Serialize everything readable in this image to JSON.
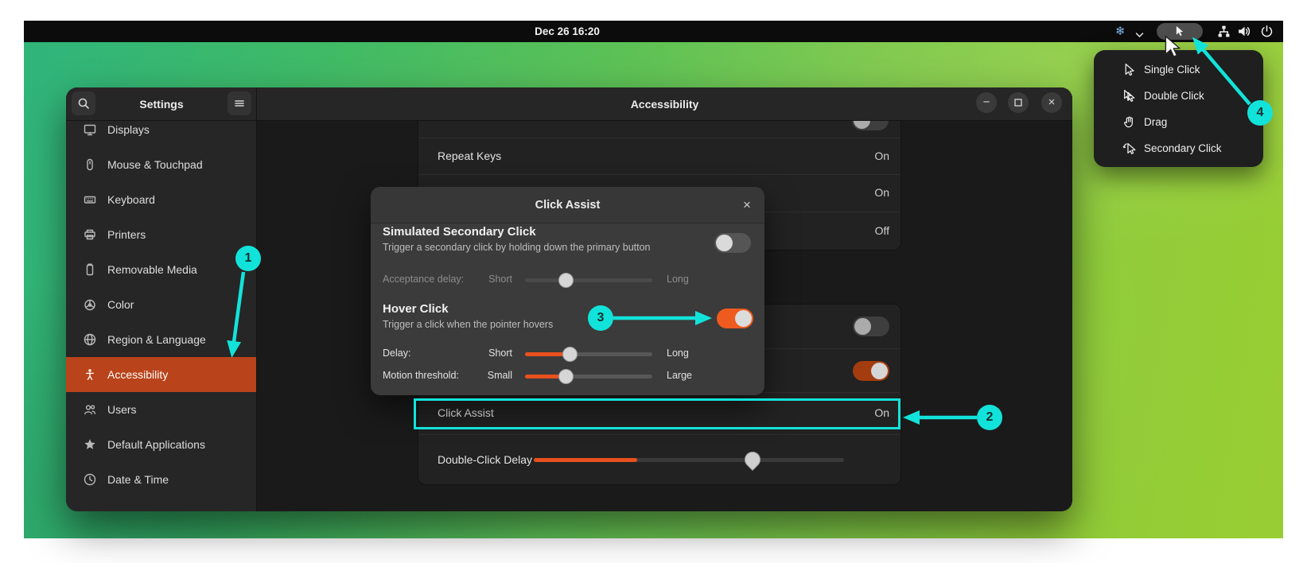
{
  "topbar": {
    "clock": "Dec 26 16:20",
    "snowflake_icon": "❄"
  },
  "tray_menu": {
    "items": [
      {
        "icon": "single-click-cursor-icon",
        "label": "Single Click"
      },
      {
        "icon": "double-click-cursor-icon",
        "label": "Double Click"
      },
      {
        "icon": "drag-hand-icon",
        "label": "Drag"
      },
      {
        "icon": "secondary-click-cursor-icon",
        "label": "Secondary Click"
      }
    ]
  },
  "window": {
    "sidebar_title": "Settings",
    "sidebar_items": [
      {
        "icon": "display-icon",
        "label": "Displays"
      },
      {
        "icon": "mouse-icon",
        "label": "Mouse & Touchpad"
      },
      {
        "icon": "keyboard-icon",
        "label": "Keyboard"
      },
      {
        "icon": "printer-icon",
        "label": "Printers"
      },
      {
        "icon": "removable-media-icon",
        "label": "Removable Media"
      },
      {
        "icon": "color-icon",
        "label": "Color"
      },
      {
        "icon": "globe-icon",
        "label": "Region & Language"
      },
      {
        "icon": "accessibility-icon",
        "label": "Accessibility",
        "selected": true
      },
      {
        "icon": "users-icon",
        "label": "Users"
      },
      {
        "icon": "star-icon",
        "label": "Default Applications"
      },
      {
        "icon": "clock-icon",
        "label": "Date & Time"
      }
    ],
    "title": "Accessibility",
    "controls": {
      "minimize": "−",
      "close": "×"
    },
    "typing_card": {
      "rows": [
        {
          "label": "Repeat Keys",
          "value": "On"
        },
        {
          "value": "On"
        },
        {
          "value": "Off"
        }
      ]
    },
    "pointing_card": {
      "click_assist": {
        "label": "Click Assist",
        "value": "On"
      },
      "double_click_delay": {
        "label": "Double-Click Delay"
      }
    }
  },
  "dialog": {
    "title": "Click Assist",
    "close": "×",
    "simulated_secondary_click": {
      "title": "Simulated Secondary Click",
      "subtitle": "Trigger a secondary click by holding down the primary button",
      "toggle": "off"
    },
    "acceptance_delay": {
      "label": "Acceptance delay:",
      "min": "Short",
      "max": "Long",
      "value_fraction": 0.32,
      "enabled": false
    },
    "hover_click": {
      "title": "Hover Click",
      "subtitle": "Trigger a click when the pointer hovers",
      "toggle": "on"
    },
    "delay": {
      "label": "Delay:",
      "min": "Short",
      "max": "Long",
      "value_fraction": 0.36
    },
    "motion_threshold": {
      "label": "Motion threshold:",
      "min": "Small",
      "max": "Large",
      "value_fraction": 0.33
    }
  },
  "annotations": {
    "color": "#12e3da",
    "badges": [
      "1",
      "2",
      "3",
      "4"
    ]
  },
  "colors": {
    "sidebar_selected_orange": "#b9431a",
    "toggle_on_orange": "#ef5b1e",
    "slider_fill_orange": "#e8501e",
    "annotation_cyan": "#12e3da",
    "desktop_green_left": "#2fb47b",
    "desktop_green_right": "#99ce33"
  }
}
